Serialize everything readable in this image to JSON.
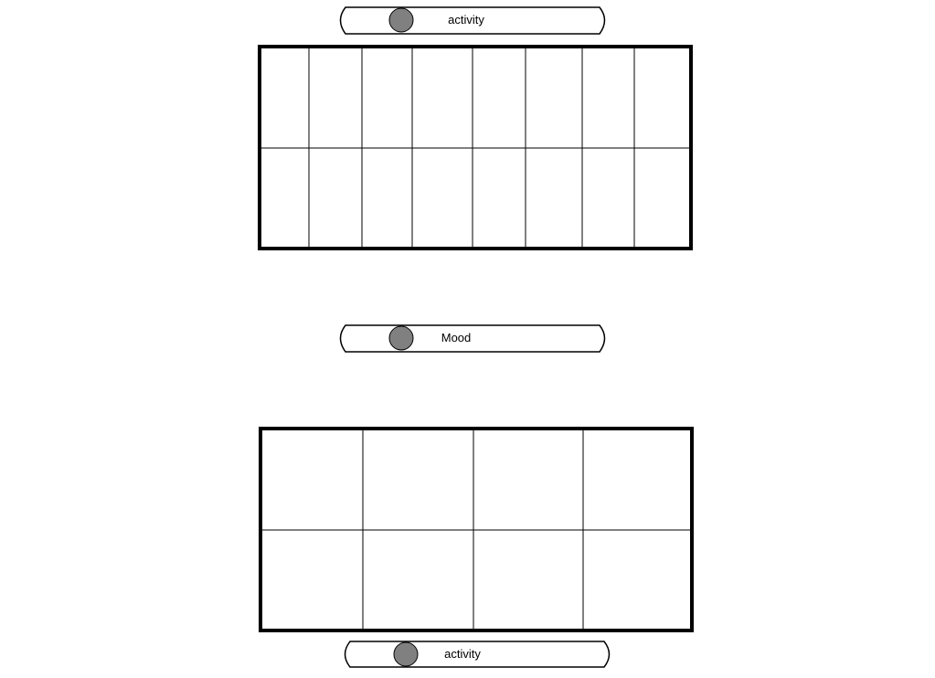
{
  "toggles": {
    "top": {
      "label": "activity"
    },
    "middle": {
      "label": "Mood"
    },
    "bottom": {
      "label": "activity"
    }
  },
  "grids": {
    "top": {
      "rows": 2,
      "columns": 8
    },
    "bottom": {
      "rows": 2,
      "columns": 4
    }
  },
  "colors": {
    "knob": "#808080",
    "stroke": "#000000",
    "background": "#ffffff"
  }
}
